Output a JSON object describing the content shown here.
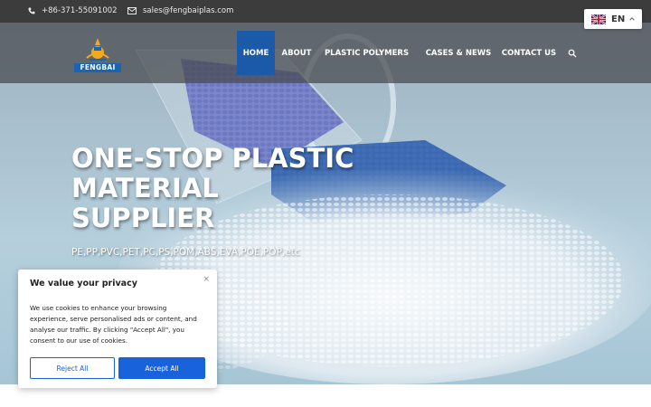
{
  "topbar": {
    "phone": "+86-371-55091002",
    "email": "sales@fengbaiplas.com",
    "phone_icon": "phone-icon",
    "email_icon": "envelope-icon"
  },
  "language": {
    "code": "EN",
    "flag_icon": "uk-flag-icon"
  },
  "brand": {
    "name": "FENGBAI"
  },
  "nav": {
    "items": [
      {
        "label": "HOME",
        "active": true
      },
      {
        "label": "ABOUT"
      },
      {
        "label": "PLASTIC POLYMERS",
        "has_dropdown": true
      },
      {
        "label": "CASES & NEWS"
      },
      {
        "label": "CONTACT US"
      }
    ],
    "search_icon": "search-icon"
  },
  "hero": {
    "title_lines": [
      "ONE-STOP PLASTIC",
      "MATERIAL",
      "SUPPLIER"
    ],
    "subtitle": "PE,PP,PVC,PET,PC,PS,POM,ABS,EVA,POE,POP,etc"
  },
  "cookie": {
    "title": "We value your privacy",
    "text": "We use cookies to enhance your browsing experience, serve personalised ads or content, and analyse our traffic. By clicking \"Accept All\", you consent to our use of cookies.",
    "reject_label": "Reject All",
    "accept_label": "Accept All",
    "close_symbol": "×"
  },
  "colors": {
    "topbar": "#3c3c3c",
    "nav_active": "#1a5aa8",
    "accent_blue": "#1863dc"
  }
}
